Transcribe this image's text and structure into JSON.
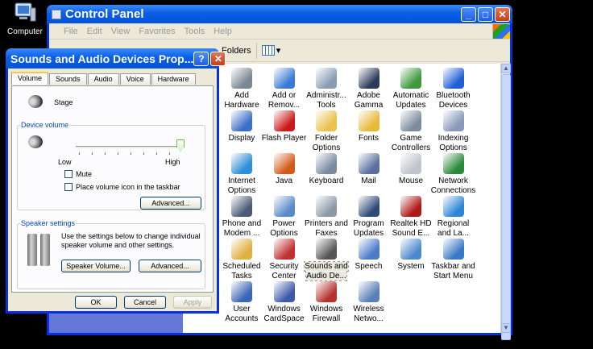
{
  "desktop": {
    "icon_label": "Computer"
  },
  "control_panel": {
    "title": "Control Panel",
    "menu": [
      "File",
      "Edit",
      "View",
      "Favorites",
      "Tools",
      "Help"
    ],
    "toolbar": {
      "folders_label": "Folders"
    },
    "items": [
      {
        "label": "Add Hardware",
        "color": "#7a8794"
      },
      {
        "label": "Add or Remov...",
        "color": "#3a7bd5"
      },
      {
        "label": "Administr... Tools",
        "color": "#8a9bb4"
      },
      {
        "label": "Adobe Gamma",
        "color": "#2a3b5a"
      },
      {
        "label": "Automatic Updates",
        "color": "#3c9a3c"
      },
      {
        "label": "Bluetooth Devices",
        "color": "#1d5fd6"
      },
      {
        "label": "Display",
        "color": "#3b6fc8"
      },
      {
        "label": "Flash Player",
        "color": "#cc1a1a"
      },
      {
        "label": "Folder Options",
        "color": "#e8c24a"
      },
      {
        "label": "Fonts",
        "color": "#e8b838"
      },
      {
        "label": "Game Controllers",
        "color": "#7d8c9e"
      },
      {
        "label": "Indexing Options",
        "color": "#8898b8"
      },
      {
        "label": "Internet Options",
        "color": "#2d8fd8"
      },
      {
        "label": "Java",
        "color": "#d45a1a"
      },
      {
        "label": "Keyboard",
        "color": "#7a8aa2"
      },
      {
        "label": "Mail",
        "color": "#5a6f9c"
      },
      {
        "label": "Mouse",
        "color": "#c0c4cc"
      },
      {
        "label": "Network Connections",
        "color": "#2a8a3a"
      },
      {
        "label": "Phone and Modem ...",
        "color": "#4a5a78"
      },
      {
        "label": "Power Options",
        "color": "#5a8ac8"
      },
      {
        "label": "Printers and Faxes",
        "color": "#8c98a8"
      },
      {
        "label": "Program Updates",
        "color": "#2f4a78"
      },
      {
        "label": "Realtek HD Sound E...",
        "color": "#b01818"
      },
      {
        "label": "Regional and La...",
        "color": "#2e86d6"
      },
      {
        "label": "Scheduled Tasks",
        "color": "#e0b040"
      },
      {
        "label": "Security Center",
        "color": "#c03030"
      },
      {
        "label": "Sounds and Audio De...",
        "color": "#555555",
        "selected": true
      },
      {
        "label": "Speech",
        "color": "#4a7ac8"
      },
      {
        "label": "System",
        "color": "#4c8ad0"
      },
      {
        "label": "Taskbar and Start Menu",
        "color": "#3a78c8"
      },
      {
        "label": "User Accounts",
        "color": "#3b66b8"
      },
      {
        "label": "Windows CardSpace",
        "color": "#3c5aa8"
      },
      {
        "label": "Windows Firewall",
        "color": "#b83030"
      },
      {
        "label": "Wireless Netwo...",
        "color": "#5a80b8"
      }
    ]
  },
  "dialog": {
    "title": "Sounds and Audio Devices Prop...",
    "tabs": [
      "Volume",
      "Sounds",
      "Audio",
      "Voice",
      "Hardware"
    ],
    "device_name": "Stage",
    "device_volume": {
      "caption": "Device volume",
      "low_label": "Low",
      "high_label": "High",
      "level": 1.0,
      "mute_label": "Mute",
      "tray_label": "Place volume icon in the taskbar",
      "advanced_label": "Advanced..."
    },
    "speaker_settings": {
      "caption": "Speaker settings",
      "description": "Use the settings below to change individual speaker volume and other settings.",
      "speaker_volume_label": "Speaker Volume...",
      "advanced_label": "Advanced..."
    },
    "buttons": {
      "ok": "OK",
      "cancel": "Cancel",
      "apply": "Apply"
    }
  }
}
